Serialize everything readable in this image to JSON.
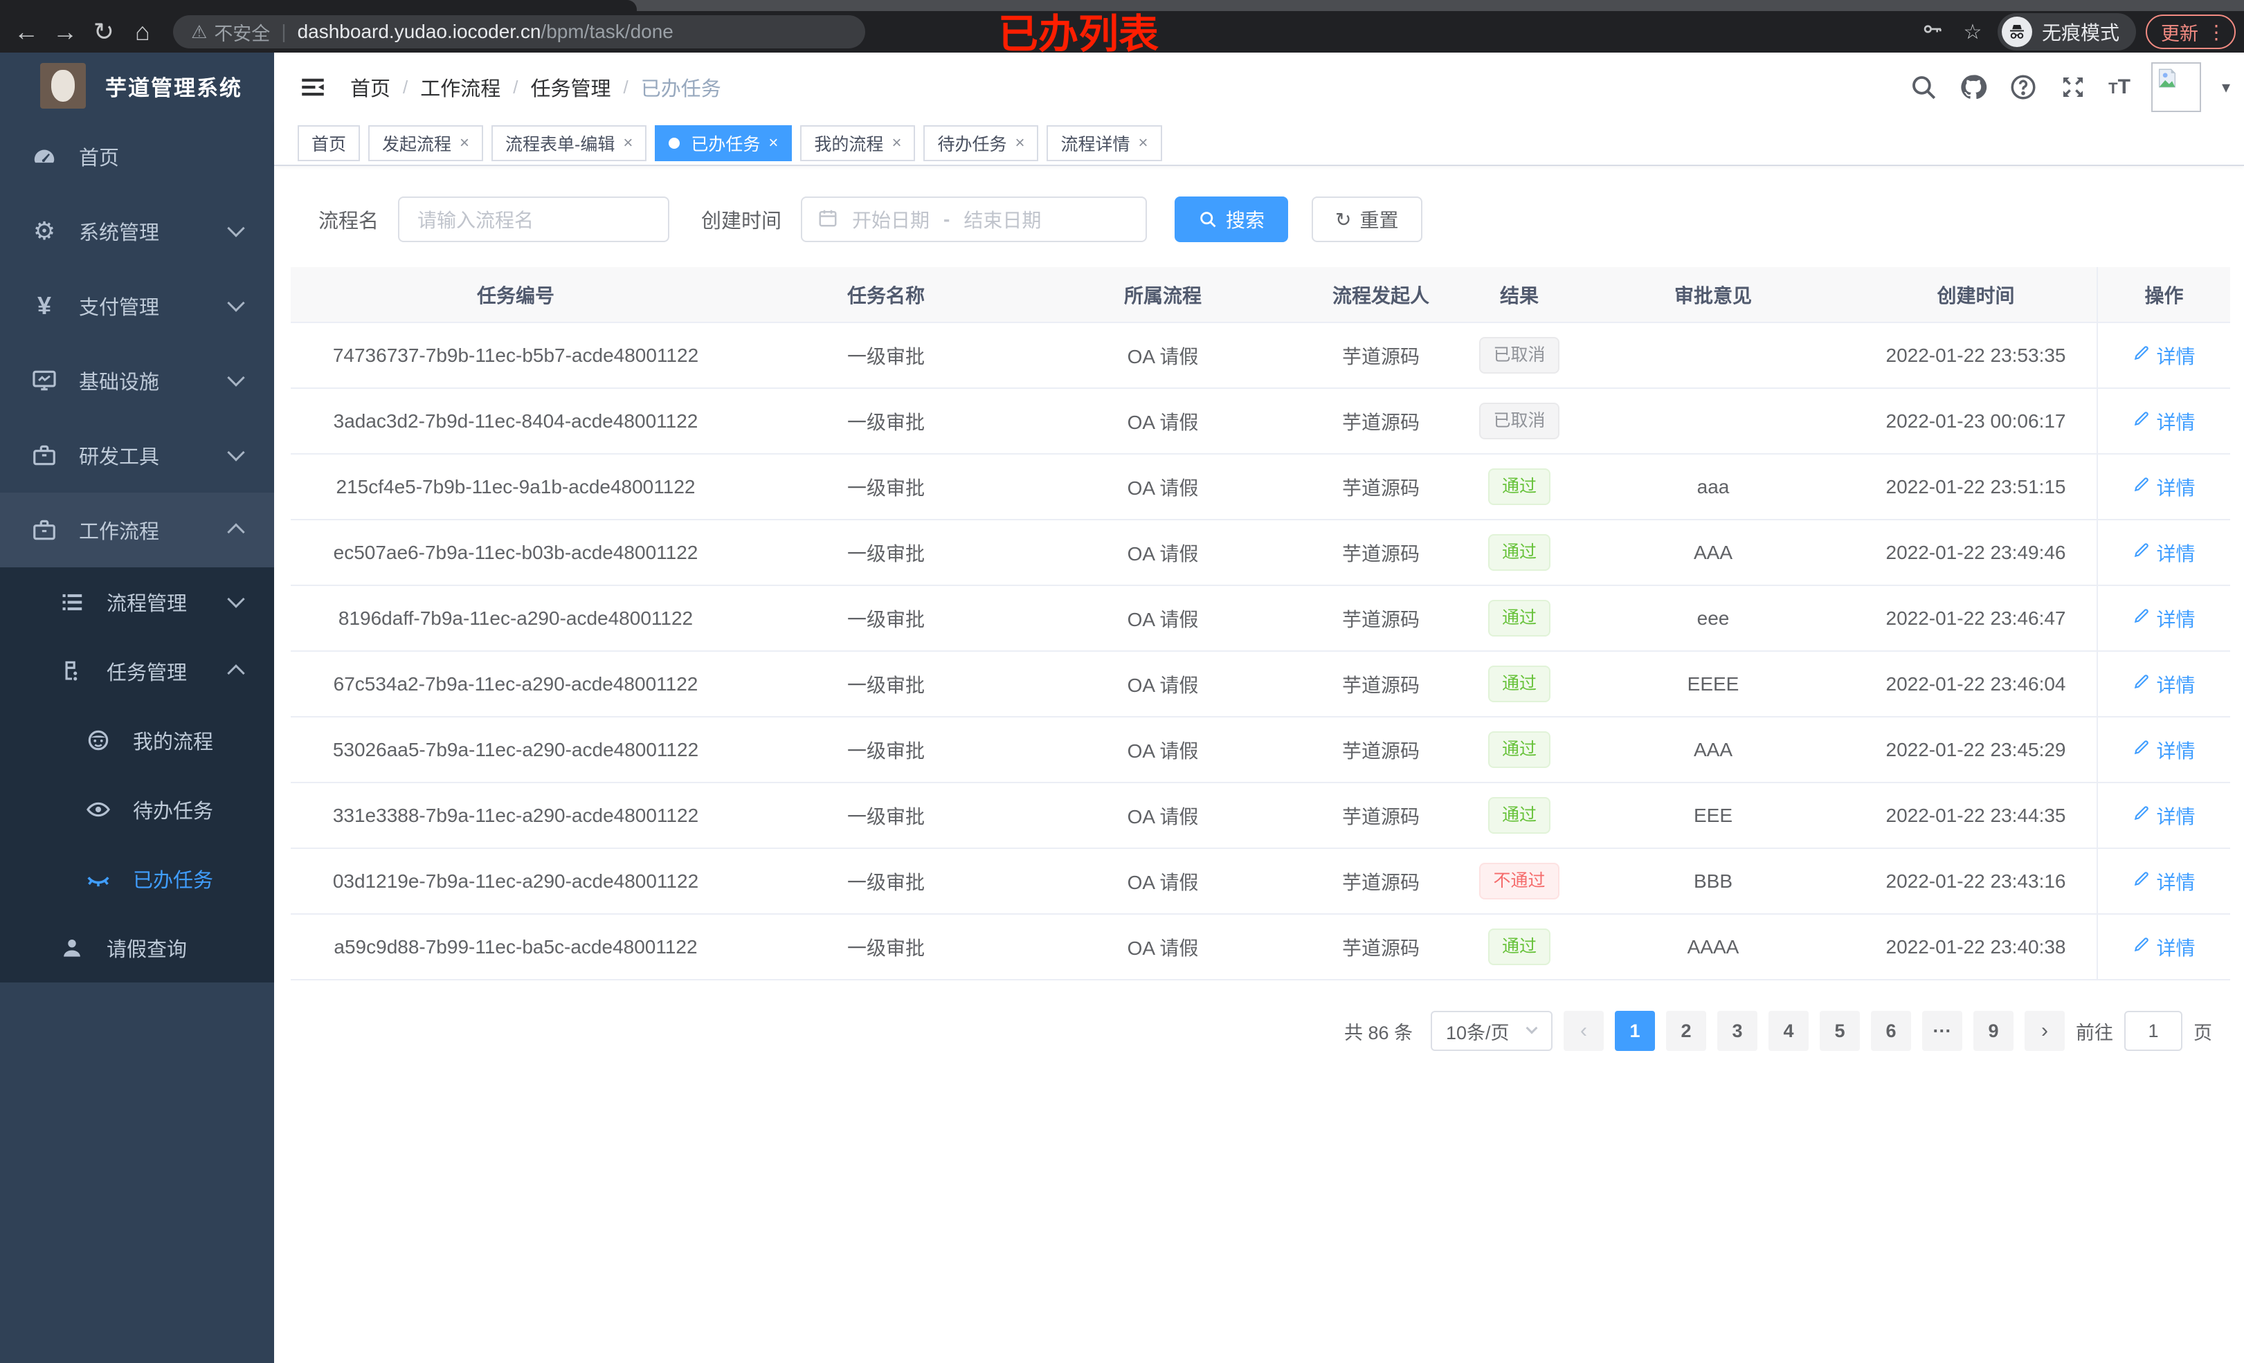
{
  "colors": {
    "accent": "#409eff",
    "success": "#67c23a",
    "danger": "#f56c6c",
    "info": "#909399",
    "sidebar": "#304156",
    "submenu": "#1f2d3d",
    "chrome": "#202124"
  },
  "browser": {
    "insecure_label": "不安全",
    "url_host": "dashboard.yudao.iocoder.cn",
    "url_path": "/bpm/task/done",
    "incognito_label": "无痕模式",
    "update_label": "更新",
    "annotation": "已办列表"
  },
  "icons": {
    "back": "←",
    "forward": "→",
    "reload": "↻",
    "home": "⌂",
    "warning": "⚠",
    "star": "☆",
    "kebab": "⋮",
    "caret_down": "▾",
    "gear": "⚙",
    "yen": "¥",
    "reset": "↻",
    "ellipsis": "···",
    "prev": "‹",
    "next": "›",
    "close": "×"
  },
  "sidebar": {
    "app_title": "芋道管理系统",
    "menu": [
      {
        "label": "首页",
        "icon": "dashboard-icon",
        "level": 1
      },
      {
        "label": "系统管理",
        "icon": "gear-icon",
        "level": 1,
        "chevron": "down"
      },
      {
        "label": "支付管理",
        "icon": "yen-icon",
        "level": 1,
        "chevron": "down"
      },
      {
        "label": "基础设施",
        "icon": "infra-icon",
        "level": 1,
        "chevron": "down"
      },
      {
        "label": "研发工具",
        "icon": "tool-icon",
        "level": 1,
        "chevron": "down"
      },
      {
        "label": "工作流程",
        "icon": "workflow-icon",
        "level": 1,
        "chevron": "up",
        "highlight": true
      },
      {
        "label": "流程管理",
        "icon": "process-icon",
        "level": 2,
        "chevron": "down",
        "sub": true
      },
      {
        "label": "任务管理",
        "icon": "task-icon",
        "level": 2,
        "chevron": "up",
        "sub": true
      },
      {
        "label": "我的流程",
        "icon": "my-process-icon",
        "level": 3,
        "sub": true
      },
      {
        "label": "待办任务",
        "icon": "todo-icon",
        "level": 3,
        "sub": true
      },
      {
        "label": "已办任务",
        "icon": "done-icon",
        "level": 3,
        "sub": true,
        "active": true
      },
      {
        "label": "请假查询",
        "icon": "leave-icon",
        "level": 2,
        "sub": true
      }
    ]
  },
  "header": {
    "breadcrumb": [
      "首页",
      "工作流程",
      "任务管理",
      "已办任务"
    ],
    "separator": "/"
  },
  "tabs": [
    {
      "label": "首页",
      "closable": false,
      "active": false
    },
    {
      "label": "发起流程",
      "closable": true,
      "active": false
    },
    {
      "label": "流程表单-编辑",
      "closable": true,
      "active": false
    },
    {
      "label": "已办任务",
      "closable": true,
      "active": true
    },
    {
      "label": "我的流程",
      "closable": true,
      "active": false
    },
    {
      "label": "待办任务",
      "closable": true,
      "active": false
    },
    {
      "label": "流程详情",
      "closable": true,
      "active": false
    }
  ],
  "filters": {
    "name_label": "流程名",
    "name_placeholder": "请输入流程名",
    "time_label": "创建时间",
    "start_placeholder": "开始日期",
    "range_separator": "-",
    "end_placeholder": "结束日期",
    "search_label": "搜索",
    "reset_label": "重置"
  },
  "table": {
    "columns": [
      "任务编号",
      "任务名称",
      "所属流程",
      "流程发起人",
      "结果",
      "审批意见",
      "创建时间",
      "操作"
    ],
    "detail_label": "详情",
    "rows": [
      {
        "id": "74736737-7b9b-11ec-b5b7-acde48001122",
        "name": "一级审批",
        "process": "OA 请假",
        "starter": "芋道源码",
        "result": "已取消",
        "result_type": "info",
        "comment": "",
        "time": "2022-01-22 23:53:35"
      },
      {
        "id": "3adac3d2-7b9d-11ec-8404-acde48001122",
        "name": "一级审批",
        "process": "OA 请假",
        "starter": "芋道源码",
        "result": "已取消",
        "result_type": "info",
        "comment": "",
        "time": "2022-01-23 00:06:17"
      },
      {
        "id": "215cf4e5-7b9b-11ec-9a1b-acde48001122",
        "name": "一级审批",
        "process": "OA 请假",
        "starter": "芋道源码",
        "result": "通过",
        "result_type": "success",
        "comment": "aaa",
        "time": "2022-01-22 23:51:15"
      },
      {
        "id": "ec507ae6-7b9a-11ec-b03b-acde48001122",
        "name": "一级审批",
        "process": "OA 请假",
        "starter": "芋道源码",
        "result": "通过",
        "result_type": "success",
        "comment": "AAA",
        "time": "2022-01-22 23:49:46"
      },
      {
        "id": "8196daff-7b9a-11ec-a290-acde48001122",
        "name": "一级审批",
        "process": "OA 请假",
        "starter": "芋道源码",
        "result": "通过",
        "result_type": "success",
        "comment": "eee",
        "time": "2022-01-22 23:46:47"
      },
      {
        "id": "67c534a2-7b9a-11ec-a290-acde48001122",
        "name": "一级审批",
        "process": "OA 请假",
        "starter": "芋道源码",
        "result": "通过",
        "result_type": "success",
        "comment": "EEEE",
        "time": "2022-01-22 23:46:04"
      },
      {
        "id": "53026aa5-7b9a-11ec-a290-acde48001122",
        "name": "一级审批",
        "process": "OA 请假",
        "starter": "芋道源码",
        "result": "通过",
        "result_type": "success",
        "comment": "AAA",
        "time": "2022-01-22 23:45:29"
      },
      {
        "id": "331e3388-7b9a-11ec-a290-acde48001122",
        "name": "一级审批",
        "process": "OA 请假",
        "starter": "芋道源码",
        "result": "通过",
        "result_type": "success",
        "comment": "EEE",
        "time": "2022-01-22 23:44:35"
      },
      {
        "id": "03d1219e-7b9a-11ec-a290-acde48001122",
        "name": "一级审批",
        "process": "OA 请假",
        "starter": "芋道源码",
        "result": "不通过",
        "result_type": "danger",
        "comment": "BBB",
        "time": "2022-01-22 23:43:16"
      },
      {
        "id": "a59c9d88-7b99-11ec-ba5c-acde48001122",
        "name": "一级审批",
        "process": "OA 请假",
        "starter": "芋道源码",
        "result": "通过",
        "result_type": "success",
        "comment": "AAAA",
        "time": "2022-01-22 23:40:38"
      }
    ]
  },
  "pagination": {
    "total_label": "共 86 条",
    "page_size_label": "10条/页",
    "pages": [
      "1",
      "2",
      "3",
      "4",
      "5",
      "6",
      "···",
      "9"
    ],
    "active_page": "1",
    "goto_label": "前往",
    "goto_value": "1",
    "page_suffix": "页"
  }
}
